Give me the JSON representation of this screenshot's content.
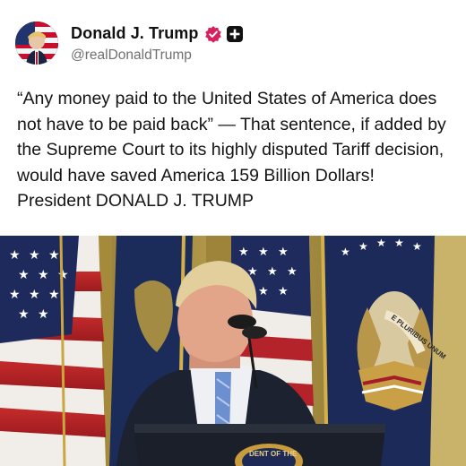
{
  "post": {
    "author": {
      "display_name": "Donald J. Trump",
      "handle": "@realDonaldTrump",
      "verified_icon": "verified-badge-icon",
      "extra_icon": "plus-square-icon",
      "verified_color": "#d6215f"
    },
    "text": "“Any money paid to the United States of America does not have to be paid back” — That sentence, if added by the Supreme Court to its highly disputed Tariff decision, would have saved America 159 Billion Dollars! President DONALD J. TRUMP",
    "media": {
      "type": "photo",
      "podium_seal_text": "DENT OF THE",
      "eagle_scroll_text": "E PLURIBUS UNUM"
    }
  }
}
